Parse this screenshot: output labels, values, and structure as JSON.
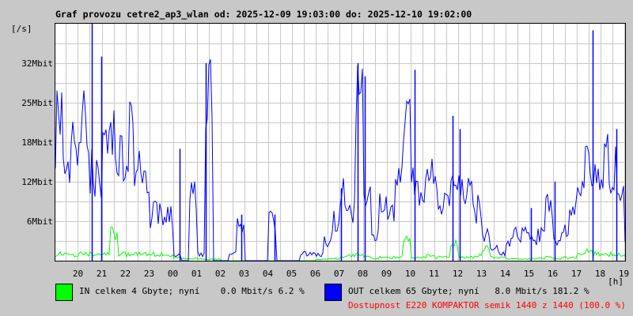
{
  "title": "Graf provozu cetre2_ap3_wlan od: 2025-12-09 19:03:00 do: 2025-12-10 19:02:00",
  "chart_data": {
    "type": "line",
    "title": "Graf provozu cetre2_ap3_wlan od: 2025-12-09 19:03:00 do: 2025-12-10 19:02:00",
    "ylabel": "[/s]",
    "xlabel": "[h]",
    "ylim": [
      0,
      36
    ],
    "y_unit": "Mbit",
    "yticks": [
      6,
      12,
      18,
      24,
      30
    ],
    "ytick_labels": [
      "6Mbit",
      "12Mbit",
      "18Mbit",
      "25Mbit",
      "32Mbit"
    ],
    "xlim_hours": [
      19.05,
      43.05
    ],
    "xticks": [
      20,
      21,
      22,
      23,
      24,
      25,
      26,
      27,
      28,
      29,
      30,
      31,
      32,
      33,
      34,
      35,
      36,
      37,
      38,
      39,
      40,
      41,
      42,
      43
    ],
    "xtick_labels": [
      "20",
      "21",
      "22",
      "23",
      "00",
      "01",
      "02",
      "03",
      "04",
      "05",
      "06",
      "07",
      "08",
      "09",
      "10",
      "11",
      "12",
      "13",
      "14",
      "15",
      "16",
      "17",
      "18",
      "19"
    ],
    "grid": true,
    "sample_interval_min": 20,
    "series": [
      {
        "name": "OUT",
        "color": "#0000ff",
        "values": [
          20,
          15,
          17,
          25,
          14,
          12,
          17,
          18,
          17,
          19,
          16,
          11,
          7,
          7,
          7,
          1,
          0,
          10,
          1,
          25,
          0,
          0,
          1,
          5,
          0,
          0,
          0,
          6,
          0,
          0,
          0,
          1,
          1,
          1,
          3,
          6,
          10,
          8,
          25,
          10,
          4,
          8,
          7,
          12,
          20,
          11,
          10,
          12,
          10,
          9,
          15,
          10,
          10,
          8,
          4,
          2,
          1,
          3,
          4,
          4,
          3,
          4,
          8,
          3,
          5,
          7,
          10,
          14,
          14,
          15,
          14,
          9,
          4
        ],
        "peaks": [
          [
            20.6,
            36
          ],
          [
            21.0,
            31
          ],
          [
            24.3,
            17
          ],
          [
            25.4,
            30
          ],
          [
            26.9,
            7
          ],
          [
            28.3,
            7
          ],
          [
            31.1,
            11
          ],
          [
            31.8,
            30
          ],
          [
            32.1,
            28
          ],
          [
            34.2,
            29
          ],
          [
            35.8,
            22
          ],
          [
            36.1,
            20
          ],
          [
            39.1,
            8
          ],
          [
            40.1,
            12
          ],
          [
            41.7,
            35
          ],
          [
            42.7,
            20
          ]
        ]
      },
      {
        "name": "IN",
        "color": "#00ff00",
        "values": [
          1,
          1,
          1,
          1,
          1,
          1.2,
          1,
          4,
          1,
          1,
          1,
          1,
          1,
          1,
          0.8,
          0.5,
          0.3,
          0.3,
          0.3,
          0.2,
          0.2,
          0,
          0,
          0,
          0,
          0,
          0,
          0,
          0,
          0,
          0,
          0,
          0,
          0.2,
          0.3,
          0.3,
          0.5,
          0.8,
          1,
          0.5,
          0.3,
          0.5,
          0.5,
          0.5,
          3,
          0.5,
          0.5,
          0.8,
          0.5,
          0.5,
          3,
          0.5,
          0.5,
          0.8,
          2,
          0.5,
          0.5,
          0.3,
          0.3,
          0.3,
          0.3,
          0.3,
          0.5,
          0.3,
          0.5,
          0.5,
          1,
          1.5,
          1,
          1,
          1,
          1,
          0.8
        ]
      }
    ]
  },
  "legend": {
    "in": {
      "label": "IN celkem 4 Gbyte; nyní    0.0 Mbit/s 6.2 %",
      "color": "#00ff00"
    },
    "out": {
      "label": "OUT celkem 65 Gbyte; nyní   8.0 Mbit/s 181.2 %",
      "color": "#0000ff"
    },
    "availability": {
      "label": "Dostupnost E220 KOMPAKTOR semik 1440 z 1440 (100.0 %)",
      "color": "#ff0000"
    }
  }
}
